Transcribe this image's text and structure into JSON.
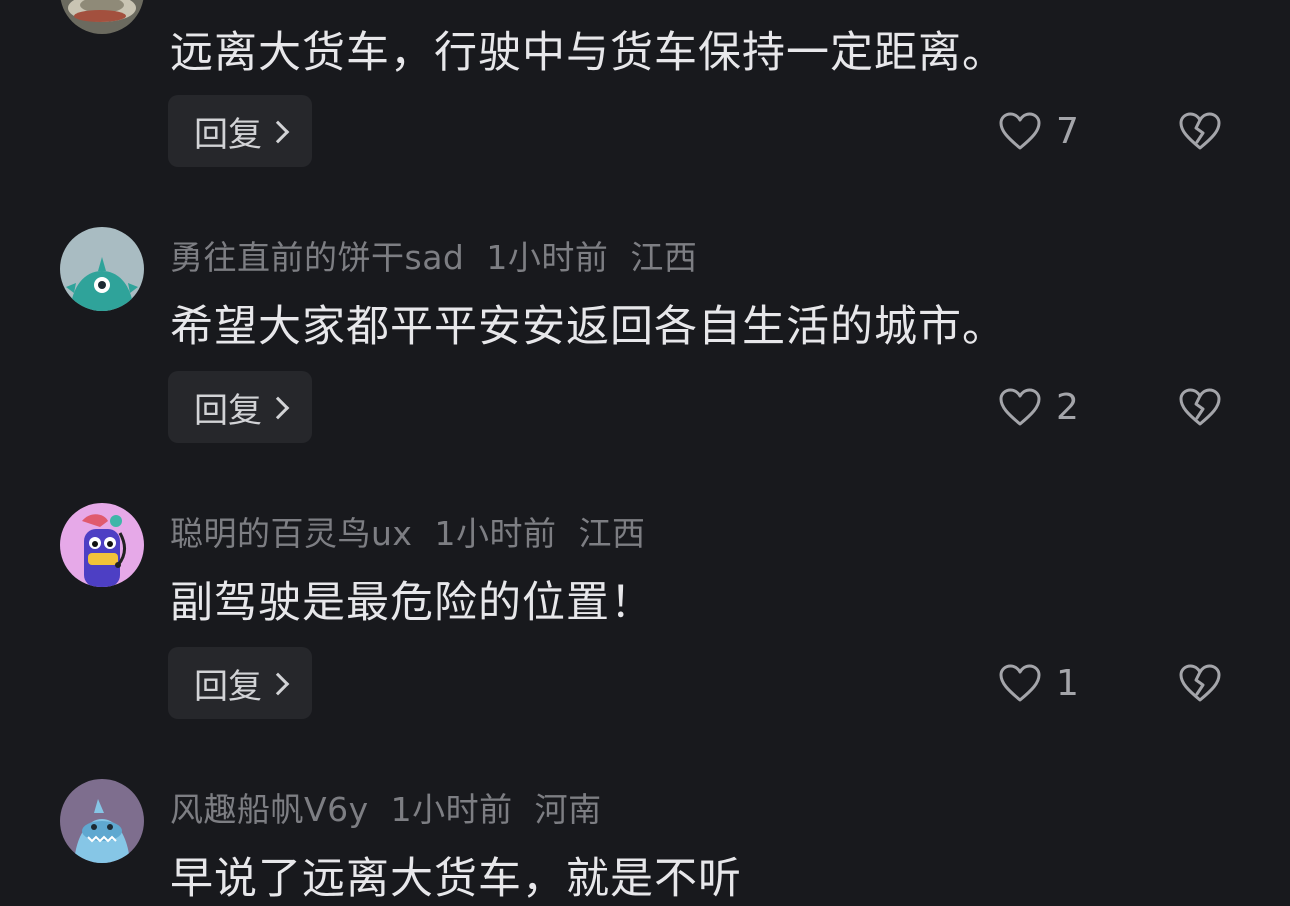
{
  "comments": [
    {
      "author": "",
      "time": "",
      "location": "",
      "text": "远离大货车，行驶中与货车保持一定距离。",
      "reply_label": "回复",
      "likes": "7",
      "avatar_icon": "teacup-photo-avatar"
    },
    {
      "author": "勇往直前的饼干sad",
      "time": "1小时前",
      "location": "江西",
      "text": "希望大家都平平安安返回各自生活的城市。",
      "reply_label": "回复",
      "likes": "2",
      "avatar_icon": "teal-monster-avatar"
    },
    {
      "author": "聪明的百灵鸟ux",
      "time": "1小时前",
      "location": "江西",
      "text": "副驾驶是最危险的位置！",
      "reply_label": "回复",
      "likes": "1",
      "avatar_icon": "purple-bird-avatar"
    },
    {
      "author": "风趣船帆V6y",
      "time": "1小时前",
      "location": "河南",
      "text": "早说了远离大货车，就是不听",
      "reply_label": "",
      "likes": "",
      "avatar_icon": "blue-shark-avatar"
    }
  ],
  "colors": {
    "background": "#18191d",
    "text": "#e7e7ea",
    "meta": "#7d7e83",
    "button_bg": "#26272b"
  }
}
